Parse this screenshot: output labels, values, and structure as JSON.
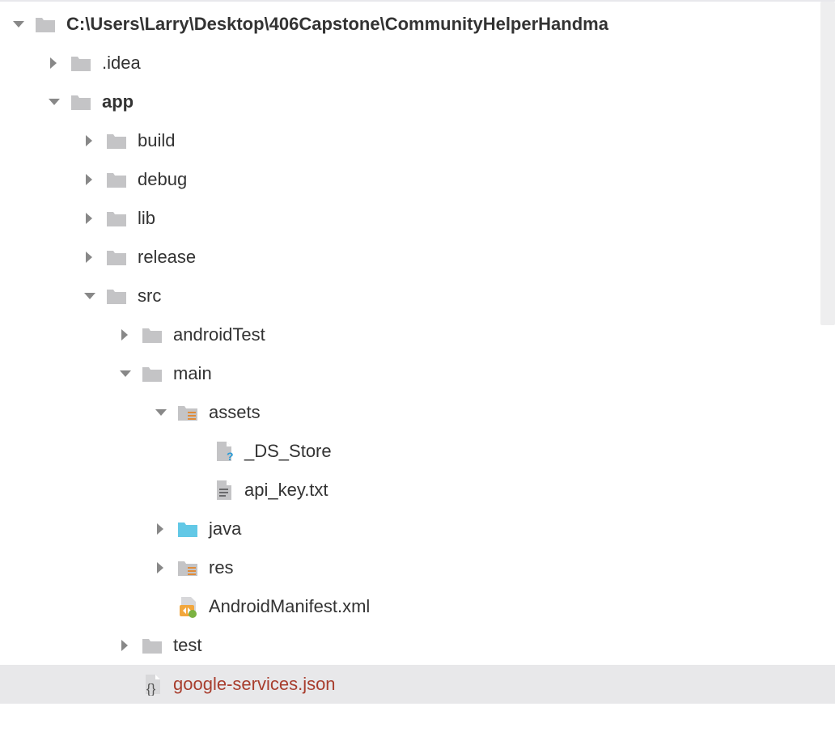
{
  "tree": {
    "root": "C:\\Users\\Larry\\Desktop\\406Capstone\\CommunityHelperHandma",
    "nodes": [
      {
        "label": ".idea"
      },
      {
        "label": "app"
      },
      {
        "label": "build"
      },
      {
        "label": "debug"
      },
      {
        "label": "lib"
      },
      {
        "label": "release"
      },
      {
        "label": "src"
      },
      {
        "label": "androidTest"
      },
      {
        "label": "main"
      },
      {
        "label": "assets"
      },
      {
        "label": "_DS_Store"
      },
      {
        "label": "api_key.txt"
      },
      {
        "label": "java"
      },
      {
        "label": "res"
      },
      {
        "label": "AndroidManifest.xml"
      },
      {
        "label": "test"
      },
      {
        "label": "google-services.json"
      }
    ]
  }
}
